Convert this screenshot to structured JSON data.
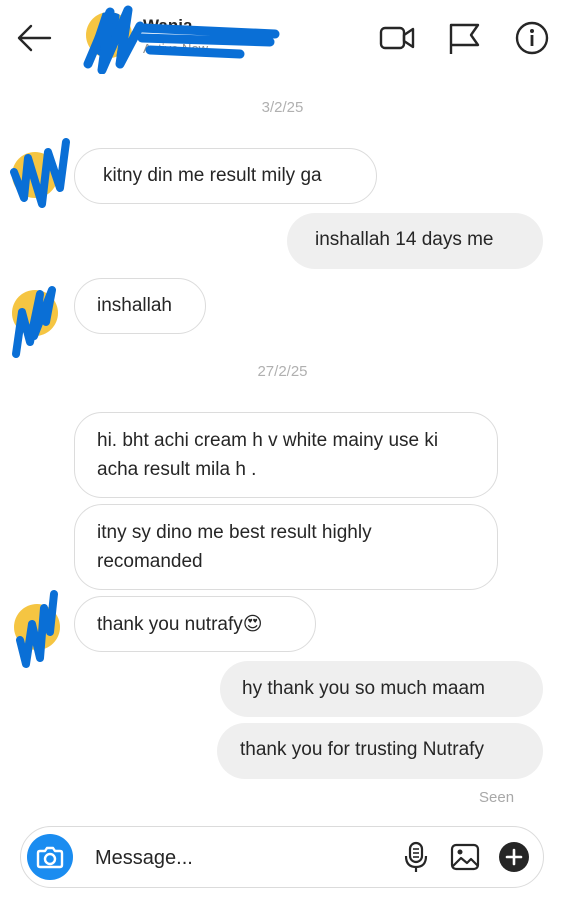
{
  "header": {
    "contact_name": "Wania",
    "status": "Active Now",
    "icons": [
      "back-arrow-icon",
      "video-camera-icon",
      "flag-icon",
      "info-icon"
    ]
  },
  "conversation": {
    "date_separators": [
      "3/2/25",
      "27/2/25"
    ],
    "messages": [
      {
        "direction": "in",
        "text": "kitny din me result mily ga"
      },
      {
        "direction": "out",
        "text": "inshallah 14 days me"
      },
      {
        "direction": "in",
        "text": "inshallah"
      },
      {
        "direction": "in",
        "text": "hi. bht achi cream h v white mainy use ki acha result mila h ."
      },
      {
        "direction": "in",
        "text": "itny sy dino me best result highly recomanded"
      },
      {
        "direction": "in",
        "text": "thank you nutrafy😍"
      },
      {
        "direction": "out",
        "text": "hy thank you so much maam"
      },
      {
        "direction": "out",
        "text": "thank you for trusting Nutrafy"
      }
    ],
    "seen_label": "Seen"
  },
  "composer": {
    "placeholder": "Message...",
    "icons": [
      "camera-icon",
      "microphone-icon",
      "gallery-icon",
      "plus-icon"
    ]
  },
  "colors": {
    "accent_blue": "#1a8cf0",
    "avatar_yellow": "#f5c542",
    "scribble_blue": "#0a6fd6",
    "outgoing_bubble": "#efefef"
  }
}
